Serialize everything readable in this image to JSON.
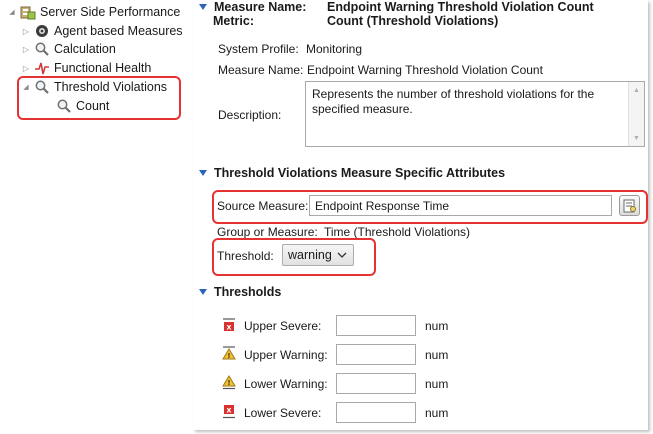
{
  "tree": {
    "root": "Server Side Performance",
    "items": [
      {
        "label": "Agent based Measures"
      },
      {
        "label": "Calculation"
      },
      {
        "label": "Functional Health"
      },
      {
        "label": "Threshold Violations"
      }
    ],
    "child": "Count"
  },
  "header": {
    "measure_name_label": "Measure Name:",
    "metric_label": "Metric:",
    "measure_name_value": "Endpoint Warning Threshold Violation Count",
    "metric_value": "Count (Threshold Violations)"
  },
  "general": {
    "system_profile_label": "System Profile:",
    "system_profile_value": "Monitoring",
    "measure_name_label": "Measure Name:",
    "measure_name_value": "Endpoint Warning Threshold Violation Count",
    "description_label": "Description:",
    "description_value": "Represents the number of threshold violations for the specified measure."
  },
  "specific": {
    "title": "Threshold Violations Measure Specific Attributes",
    "source_measure_label": "Source Measure:",
    "source_measure_value": "Endpoint Response Time",
    "group_label": "Group or Measure:",
    "group_value": "Time (Threshold Violations)",
    "threshold_label": "Threshold:",
    "threshold_value": "warning"
  },
  "thresholds": {
    "title": "Thresholds",
    "rows": [
      {
        "label": "Upper Severe:",
        "value": "",
        "unit": "num"
      },
      {
        "label": "Upper Warning:",
        "value": "",
        "unit": "num"
      },
      {
        "label": "Lower Warning:",
        "value": "",
        "unit": "num"
      },
      {
        "label": "Lower Severe:",
        "value": "",
        "unit": "num"
      }
    ]
  },
  "colors": {
    "highlight": "#e53333",
    "accent": "#2d64b8"
  }
}
